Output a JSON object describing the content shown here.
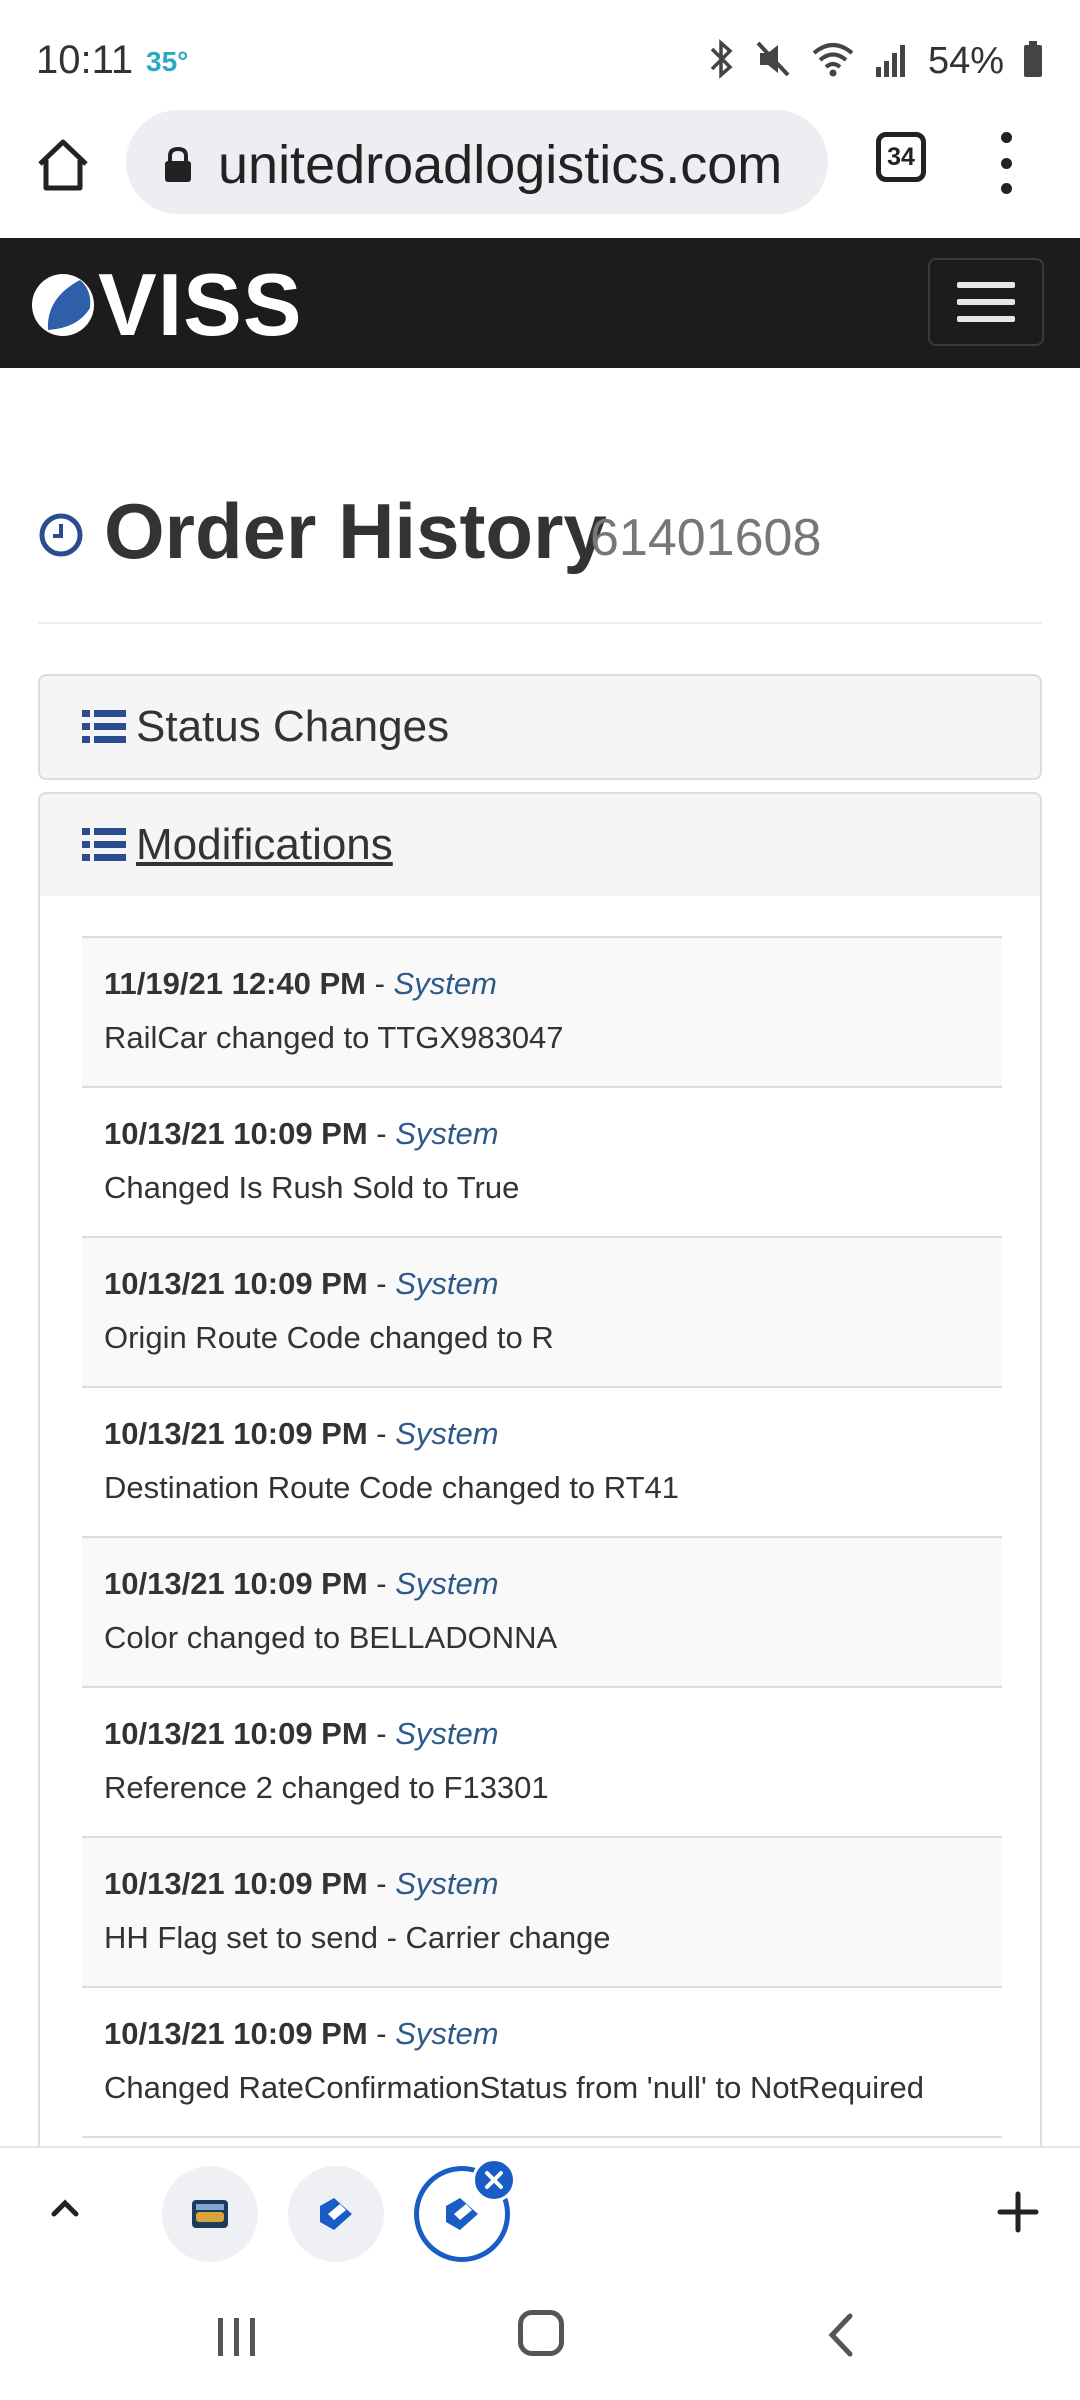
{
  "status_bar": {
    "time": "10:11",
    "temperature": "35°",
    "battery": "54%"
  },
  "browser": {
    "url": "unitedroadlogistics.com",
    "tab_count": "34"
  },
  "site": {
    "logo": "VISS"
  },
  "page": {
    "title": "Order History",
    "order_number": "61401608"
  },
  "panels": {
    "status_changes": "Status Changes",
    "modifications": "Modifications"
  },
  "modifications": [
    {
      "date": "11/19/21 12:40 PM",
      "sep": " - ",
      "user": "System",
      "text": "RailCar changed to TTGX983047"
    },
    {
      "date": "10/13/21 10:09 PM",
      "sep": " - ",
      "user": "System",
      "text": "Changed Is Rush Sold to True"
    },
    {
      "date": "10/13/21 10:09 PM",
      "sep": " - ",
      "user": "System",
      "text": "Origin Route Code changed to R"
    },
    {
      "date": "10/13/21 10:09 PM",
      "sep": " - ",
      "user": "System",
      "text": "Destination Route Code changed to RT41"
    },
    {
      "date": "10/13/21 10:09 PM",
      "sep": " - ",
      "user": "System",
      "text": "Color changed to BELLADONNA"
    },
    {
      "date": "10/13/21 10:09 PM",
      "sep": " - ",
      "user": "System",
      "text": "Reference 2 changed to F13301"
    },
    {
      "date": "10/13/21 10:09 PM",
      "sep": " - ",
      "user": "System",
      "text": "HH Flag set to send - Carrier change"
    },
    {
      "date": "10/13/21 10:09 PM",
      "sep": " - ",
      "user": "System",
      "text": "Changed RateConfirmationStatus from 'null' to NotRequired"
    }
  ],
  "colors": {
    "navbar": "#1c1c1c",
    "accent": "#1a5cc6",
    "user_link": "#2e5a8a",
    "temp": "#2aa8c4"
  },
  "icons": {
    "status_bar": [
      "bluetooth-icon",
      "mute-icon",
      "wifi-icon",
      "signal-icon",
      "battery-icon"
    ],
    "browser": [
      "home-icon",
      "lock-icon",
      "tabs-icon",
      "more-vert-icon"
    ],
    "page": [
      "clock-icon",
      "list-icon"
    ],
    "tab_strip": [
      "chevron-up-icon",
      "tab-thumbnail-icon",
      "close-icon",
      "plus-icon"
    ],
    "android": [
      "recents-icon",
      "home-icon",
      "back-icon"
    ]
  }
}
